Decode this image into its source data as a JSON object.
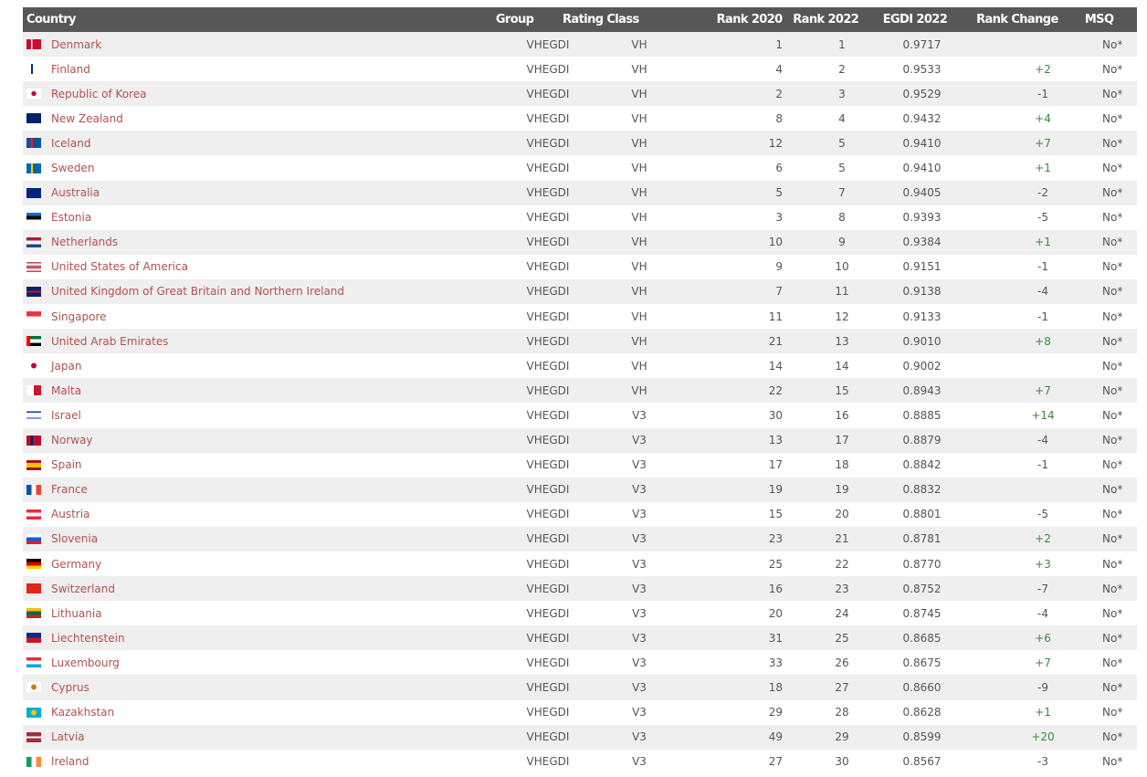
{
  "colors": {
    "header_bg": "#575757",
    "country_link": "#b0524c",
    "positive": "#3a8a3a",
    "stripe": "#efefef"
  },
  "headers": [
    "Country",
    "Group",
    "Rating Class",
    "Rank 2020",
    "Rank 2022",
    "EGDI 2022",
    "Rank Change",
    "MSQ"
  ],
  "rows": [
    {
      "country": "Denmark",
      "flag": "linear-gradient(90deg,#c8102e 0 30%,#fff 30% 42%,#c8102e 42%)",
      "group": "VHEGDI",
      "rating": "VH",
      "r2020": "1",
      "r2022": "1",
      "egdi": "0.9717",
      "change": "",
      "msq": "No*"
    },
    {
      "country": "Finland",
      "flag": "linear-gradient(90deg,#fff 0 30%,#003580 30% 45%,#fff 45%)",
      "group": "VHEGDI",
      "rating": "VH",
      "r2020": "4",
      "r2022": "2",
      "egdi": "0.9533",
      "change": "+2",
      "msq": "No*"
    },
    {
      "country": "Republic of Korea",
      "flag": "radial-gradient(circle,#c60c30 0 25%,#fff 30%)",
      "group": "VHEGDI",
      "rating": "VH",
      "r2020": "2",
      "r2022": "3",
      "egdi": "0.9529",
      "change": "-1",
      "msq": "No*"
    },
    {
      "country": "New Zealand",
      "flag": "linear-gradient(#012169,#012169)",
      "group": "VHEGDI",
      "rating": "VH",
      "r2020": "8",
      "r2022": "4",
      "egdi": "0.9432",
      "change": "+4",
      "msq": "No*"
    },
    {
      "country": "Iceland",
      "flag": "linear-gradient(90deg,#02529c 0 28%,#dc1e35 28% 44%,#02529c 44%)",
      "group": "VHEGDI",
      "rating": "VH",
      "r2020": "12",
      "r2022": "5",
      "egdi": "0.9410",
      "change": "+7",
      "msq": "No*"
    },
    {
      "country": "Sweden",
      "flag": "linear-gradient(90deg,#006aa7 0 30%,#fecc00 30% 45%,#006aa7 45%)",
      "group": "VHEGDI",
      "rating": "VH",
      "r2020": "6",
      "r2022": "5",
      "egdi": "0.9410",
      "change": "+1",
      "msq": "No*"
    },
    {
      "country": "Australia",
      "flag": "linear-gradient(#00247d,#00247d)",
      "group": "VHEGDI",
      "rating": "VH",
      "r2020": "5",
      "r2022": "7",
      "egdi": "0.9405",
      "change": "-2",
      "msq": "No*"
    },
    {
      "country": "Estonia",
      "flag": "linear-gradient(#0072ce 0 33%,#000 33% 66%,#fff 66%)",
      "group": "VHEGDI",
      "rating": "VH",
      "r2020": "3",
      "r2022": "8",
      "egdi": "0.9393",
      "change": "-5",
      "msq": "No*"
    },
    {
      "country": "Netherlands",
      "flag": "linear-gradient(#ae1c28 0 33%,#fff 33% 66%,#21468b 66%)",
      "group": "VHEGDI",
      "rating": "VH",
      "r2020": "10",
      "r2022": "9",
      "egdi": "0.9384",
      "change": "+1",
      "msq": "No*"
    },
    {
      "country": "United States of America",
      "flag": "linear-gradient(#b22234,#fff,#b22234,#fff,#b22234)",
      "group": "VHEGDI",
      "rating": "VH",
      "r2020": "9",
      "r2022": "10",
      "egdi": "0.9151",
      "change": "-1",
      "msq": "No*"
    },
    {
      "country": "United Kingdom of Great Britain and Northern Ireland",
      "flag": "linear-gradient(#012169 0 40%,#c8102e 40% 60%,#012169 60%)",
      "group": "VHEGDI",
      "rating": "VH",
      "r2020": "7",
      "r2022": "11",
      "egdi": "0.9138",
      "change": "-4",
      "msq": "No*"
    },
    {
      "country": "Singapore",
      "flag": "linear-gradient(#ef3340 0 50%,#fff 50%)",
      "group": "VHEGDI",
      "rating": "VH",
      "r2020": "11",
      "r2022": "12",
      "egdi": "0.9133",
      "change": "-1",
      "msq": "No*"
    },
    {
      "country": "United Arab Emirates",
      "flag": "linear-gradient(90deg,#ff0000 0 25%,transparent 25%),linear-gradient(#00732f 0 33%,#fff 33% 66%,#000 66%)",
      "group": "VHEGDI",
      "rating": "VH",
      "r2020": "21",
      "r2022": "13",
      "egdi": "0.9010",
      "change": "+8",
      "msq": "No*"
    },
    {
      "country": "Japan",
      "flag": "radial-gradient(circle,#bc002d 0 28%,#fff 32%)",
      "group": "VHEGDI",
      "rating": "VH",
      "r2020": "14",
      "r2022": "14",
      "egdi": "0.9002",
      "change": "",
      "msq": "No*"
    },
    {
      "country": "Malta",
      "flag": "linear-gradient(90deg,#fff 0 50%,#cf142b 50%)",
      "group": "VHEGDI",
      "rating": "VH",
      "r2020": "22",
      "r2022": "15",
      "egdi": "0.8943",
      "change": "+7",
      "msq": "No*"
    },
    {
      "country": "Israel",
      "flag": "linear-gradient(#fff 0 15%,#0038b8 15% 25%,#fff 25% 75%,#0038b8 75% 85%,#fff 85%)",
      "group": "VHEGDI",
      "rating": "V3",
      "r2020": "30",
      "r2022": "16",
      "egdi": "0.8885",
      "change": "+14",
      "msq": "No*"
    },
    {
      "country": "Norway",
      "flag": "linear-gradient(90deg,#ba0c2f 0 28%,#00205b 28% 44%,#ba0c2f 44%)",
      "group": "VHEGDI",
      "rating": "V3",
      "r2020": "13",
      "r2022": "17",
      "egdi": "0.8879",
      "change": "-4",
      "msq": "No*"
    },
    {
      "country": "Spain",
      "flag": "linear-gradient(#aa151b 0 25%,#f1bf00 25% 75%,#aa151b 75%)",
      "group": "VHEGDI",
      "rating": "V3",
      "r2020": "17",
      "r2022": "18",
      "egdi": "0.8842",
      "change": "-1",
      "msq": "No*"
    },
    {
      "country": "France",
      "flag": "linear-gradient(90deg,#0055a4 0 33%,#fff 33% 66%,#ef4135 66%)",
      "group": "VHEGDI",
      "rating": "V3",
      "r2020": "19",
      "r2022": "19",
      "egdi": "0.8832",
      "change": "",
      "msq": "No*"
    },
    {
      "country": "Austria",
      "flag": "linear-gradient(#ed2939 0 33%,#fff 33% 66%,#ed2939 66%)",
      "group": "VHEGDI",
      "rating": "V3",
      "r2020": "15",
      "r2022": "20",
      "egdi": "0.8801",
      "change": "-5",
      "msq": "No*"
    },
    {
      "country": "Slovenia",
      "flag": "linear-gradient(#fff 0 33%,#005ce5 33% 66%,#ed1c24 66%)",
      "group": "VHEGDI",
      "rating": "V3",
      "r2020": "23",
      "r2022": "21",
      "egdi": "0.8781",
      "change": "+2",
      "msq": "No*"
    },
    {
      "country": "Germany",
      "flag": "linear-gradient(#000 0 33%,#dd0000 33% 66%,#ffce00 66%)",
      "group": "VHEGDI",
      "rating": "V3",
      "r2020": "25",
      "r2022": "22",
      "egdi": "0.8770",
      "change": "+3",
      "msq": "No*"
    },
    {
      "country": "Switzerland",
      "flag": "linear-gradient(#da291c,#da291c)",
      "group": "VHEGDI",
      "rating": "V3",
      "r2020": "16",
      "r2022": "23",
      "egdi": "0.8752",
      "change": "-7",
      "msq": "No*"
    },
    {
      "country": "Lithuania",
      "flag": "linear-gradient(#fdb913 0 33%,#006a44 33% 66%,#c1272d 66%)",
      "group": "VHEGDI",
      "rating": "V3",
      "r2020": "20",
      "r2022": "24",
      "egdi": "0.8745",
      "change": "-4",
      "msq": "No*"
    },
    {
      "country": "Liechtenstein",
      "flag": "linear-gradient(#002b7f 0 50%,#ce1126 50%)",
      "group": "VHEGDI",
      "rating": "V3",
      "r2020": "31",
      "r2022": "25",
      "egdi": "0.8685",
      "change": "+6",
      "msq": "No*"
    },
    {
      "country": "Luxembourg",
      "flag": "linear-gradient(#ed2939 0 33%,#fff 33% 66%,#00a1de 66%)",
      "group": "VHEGDI",
      "rating": "V3",
      "r2020": "33",
      "r2022": "26",
      "egdi": "0.8675",
      "change": "+7",
      "msq": "No*"
    },
    {
      "country": "Cyprus",
      "flag": "radial-gradient(circle,#d57800 0 25%,#fff 35%)",
      "group": "VHEGDI",
      "rating": "V3",
      "r2020": "18",
      "r2022": "27",
      "egdi": "0.8660",
      "change": "-9",
      "msq": "No*"
    },
    {
      "country": "Kazakhstan",
      "flag": "radial-gradient(circle,#fec50c 0 25%,#00afca 35%)",
      "group": "VHEGDI",
      "rating": "V3",
      "r2020": "29",
      "r2022": "28",
      "egdi": "0.8628",
      "change": "+1",
      "msq": "No*"
    },
    {
      "country": "Latvia",
      "flag": "linear-gradient(#9e3039 0 40%,#fff 40% 60%,#9e3039 60%)",
      "group": "VHEGDI",
      "rating": "V3",
      "r2020": "49",
      "r2022": "29",
      "egdi": "0.8599",
      "change": "+20",
      "msq": "No*"
    },
    {
      "country": "Ireland",
      "flag": "linear-gradient(90deg,#169b62 0 33%,#fff 33% 66%,#ff883e 66%)",
      "group": "VHEGDI",
      "rating": "V3",
      "r2020": "27",
      "r2022": "30",
      "egdi": "0.8567",
      "change": "-3",
      "msq": "No*"
    }
  ]
}
